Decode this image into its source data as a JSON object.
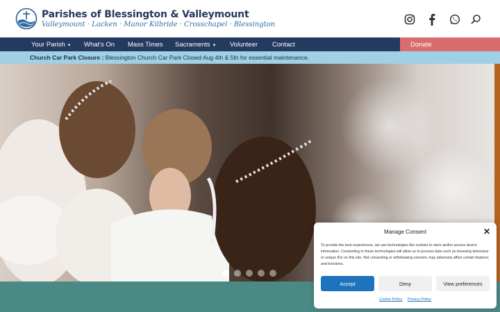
{
  "header": {
    "title": "Parishes of Blessington & Valleymount",
    "tagline": "Valleymount · Lacken · Manor Kilbride · Crosschapel · Blessington",
    "social_icons": [
      "instagram-icon",
      "facebook-icon",
      "whatsapp-icon",
      "search-icon"
    ]
  },
  "nav": {
    "items": [
      {
        "label": "Your Parish",
        "has_dropdown": true
      },
      {
        "label": "What's On",
        "has_dropdown": false
      },
      {
        "label": "Mass Times",
        "has_dropdown": false
      },
      {
        "label": "Sacraments",
        "has_dropdown": true
      },
      {
        "label": "Volunteer",
        "has_dropdown": false
      },
      {
        "label": "Contact",
        "has_dropdown": false
      }
    ],
    "donate_label": "Donate",
    "caret": "▾"
  },
  "alert": {
    "title": "Church Car Park Closure :",
    "message": "Blessington Church Car Park Closed Aug 4th & 5th for essential maintenance."
  },
  "hero": {
    "slide_count": 5,
    "active_slide": 1
  },
  "consent": {
    "title": "Manage Consent",
    "close": "✕",
    "text": "To provide the best experiences, we use technologies like cookies to store and/or access device information. Consenting to these technologies will allow us to process data such as browsing behaviour or unique IDs on this site. Not consenting or withdrawing consent, may adversely affect certain features and functions.",
    "accept_label": "Accept",
    "deny_label": "Deny",
    "prefs_label": "View preferences",
    "cookie_policy": "Cookie Policy",
    "privacy_policy": "Privacy Policy"
  },
  "colors": {
    "navy": "#243a5e",
    "donate": "#d96c6c",
    "alert": "#9fd0e6",
    "teal": "#4b8a84",
    "accent": "#1e73be"
  }
}
